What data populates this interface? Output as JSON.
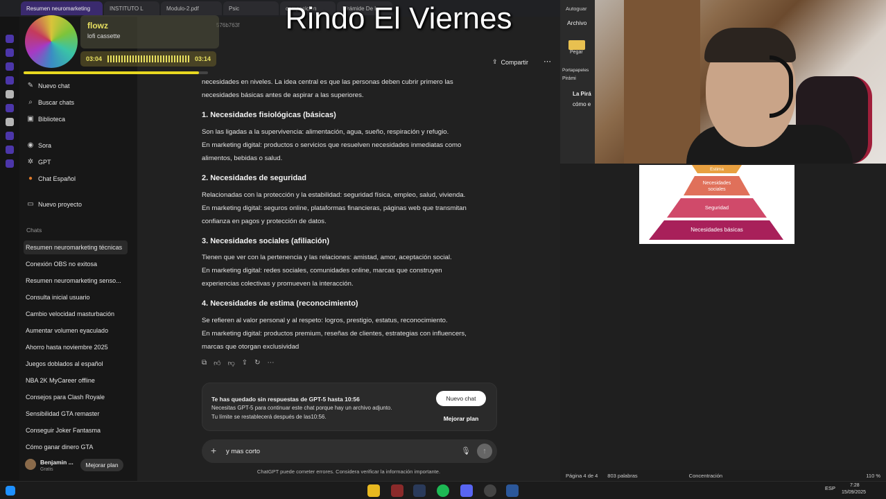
{
  "overlay_title": "Rindo El Viernes",
  "browser": {
    "tabs": [
      {
        "label": "Resumen neuromarketing",
        "active": true
      },
      {
        "label": "INSTITUTO L",
        "active": false
      },
      {
        "label": "Modulo-2.pdf",
        "active": false
      },
      {
        "label": "Psic",
        "active": false
      },
      {
        "label": "composicion",
        "active": false
      },
      {
        "label": "Pirámide De l",
        "active": false
      }
    ],
    "url_fragment": "576b763f"
  },
  "music": {
    "title": "flowz",
    "artist": "lofi cassette",
    "elapsed": "03:04",
    "total": "03:14",
    "progress_fraction": 0.95
  },
  "sidebar": {
    "items": [
      {
        "label": "Nuevo chat",
        "icon": "edit-icon"
      },
      {
        "label": "Buscar chats",
        "icon": "search-icon"
      },
      {
        "label": "Biblioteca",
        "icon": "library-icon"
      },
      {
        "label": "Sora",
        "icon": "sora-icon"
      },
      {
        "label": "GPT",
        "icon": "gpt-icon"
      },
      {
        "label": "Chat Español",
        "icon": "chat-espanol-icon"
      },
      {
        "label": "Nuevo proyecto",
        "icon": "folder-icon"
      }
    ],
    "chats_header": "Chats",
    "chats": [
      "Resumen neuromarketing técnicas",
      "Conexión OBS no exitosa",
      "Resumen neuromarketing senso...",
      "Consulta inicial usuario",
      "Cambio velocidad masturbación",
      "Aumentar volumen eyaculado",
      "Ahorro hasta noviembre 2025",
      "Juegos doblados al español",
      "NBA 2K MyCareer offline",
      "Consejos para Clash Royale",
      "Sensibilidad GTA remaster",
      "Conseguir Joker Fantasma",
      "Cómo ganar dinero GTA"
    ],
    "user_name": "Benjamin ...",
    "user_plan": "Gratis",
    "upgrade_label": "Mejorar plan"
  },
  "topbar": {
    "share_label": "Compartir"
  },
  "message": {
    "intro": [
      "necesidades en niveles. La idea central es que las personas deben cubrir primero las",
      "necesidades básicas antes de aspirar a las superiores."
    ],
    "sections": [
      {
        "heading": "1. Necesidades fisiológicas (básicas)",
        "lines": [
          "Son las ligadas a la supervivencia: alimentación, agua, sueño, respiración y refugio.",
          "En marketing digital: productos o servicios que resuelven necesidades inmediatas como",
          "alimentos, bebidas o salud."
        ]
      },
      {
        "heading": "2. Necesidades de seguridad",
        "lines": [
          "Relacionadas con la protección y la estabilidad: seguridad física, empleo, salud, vivienda.",
          "En marketing digital: seguros online, plataformas financieras, páginas web que transmitan",
          "confianza en pagos y protección de datos."
        ]
      },
      {
        "heading": "3. Necesidades sociales (afiliación)",
        "lines": [
          "Tienen que ver con la pertenencia y las relaciones: amistad, amor, aceptación social.",
          "En marketing digital: redes sociales, comunidades online, marcas que construyen",
          "experiencias colectivas y promueven la interacción."
        ]
      },
      {
        "heading": "4. Necesidades de estima (reconocimiento)",
        "lines": [
          "Se refieren al valor personal y al respeto: logros, prestigio, estatus, reconocimiento.",
          "En marketing digital: productos premium, reseñas de clientes, estrategias con influencers,",
          "marcas que otorgan exclusividad"
        ]
      }
    ]
  },
  "limit_notice": {
    "title": "Te has quedado sin respuestas de GPT-5 hasta 10:56",
    "line1": "Necesitas GPT-5 para continuar este chat porque hay un archivo adjunto.",
    "line2": "Tu límite se restablecerá después de las10:56.",
    "new_chat_label": "Nuevo chat",
    "upgrade_label": "Mejorar plan"
  },
  "composer": {
    "value": "y mas corto"
  },
  "footer_note": "ChatGPT puede cometer errores. Considera verificar la información importante.",
  "word": {
    "ribbon_labels": [
      "Autoguar",
      "Archivo",
      "Pegar",
      "Portapapeles",
      "Pirámi"
    ],
    "doc_text": [
      "La Pirá",
      "cómo e"
    ],
    "pyramid_levels": [
      "Estima",
      "Necesidades sociales",
      "Seguridad",
      "Necesidades básicas"
    ],
    "pyramid_colors": [
      "#e8a040",
      "#e0705a",
      "#d04a6a",
      "#a8205a"
    ],
    "status_page": "Página 4 de 4",
    "status_words": "803 palabras",
    "status_focus": "Concentración",
    "zoom": "110 %"
  },
  "taskbar": {
    "time": "7:28",
    "date": "15/09/2025",
    "lang": "ESP"
  }
}
